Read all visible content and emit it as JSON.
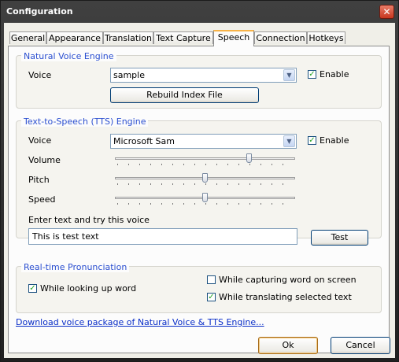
{
  "window": {
    "title": "Configuration"
  },
  "tabs": [
    "General",
    "Appearance",
    "Translation",
    "Text Capture",
    "Speech",
    "Connection",
    "Hotkeys"
  ],
  "active_tab": "Speech",
  "natural_voice": {
    "group_title": "Natural Voice Engine",
    "voice_label": "Voice",
    "voice_value": "sample",
    "enable_label": "Enable",
    "enable_checked": true,
    "rebuild_label": "Rebuild Index File"
  },
  "tts": {
    "group_title": "Text-to-Speech (TTS) Engine",
    "voice_label": "Voice",
    "voice_value": "Microsoft Sam",
    "enable_label": "Enable",
    "enable_checked": true,
    "volume_label": "Volume",
    "pitch_label": "Pitch",
    "speed_label": "Speed",
    "volume_level": 0.75,
    "pitch_level": 0.5,
    "speed_level": 0.5,
    "try_label": "Enter text and try this voice",
    "try_value": "This is test text",
    "test_label": "Test"
  },
  "pronunciation": {
    "group_title": "Real-time Pronunciation",
    "looking_up_label": "While looking up word",
    "looking_up_checked": true,
    "capturing_label": "While capturing word on screen",
    "capturing_checked": false,
    "translating_label": "While translating selected text",
    "translating_checked": true
  },
  "download_link": "Download voice package of Natural Voice & TTS Engine...",
  "footer": {
    "ok_label": "Ok",
    "cancel_label": "Cancel"
  }
}
